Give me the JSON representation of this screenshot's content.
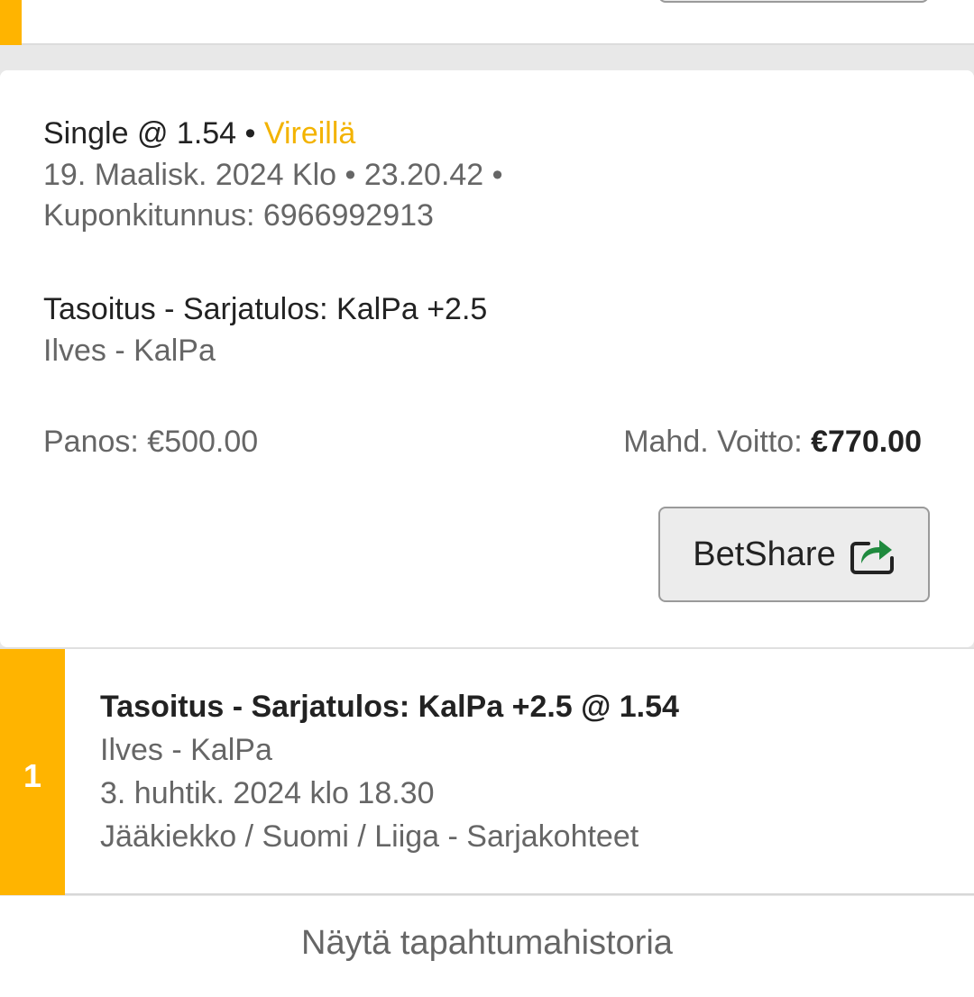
{
  "bet": {
    "type_prefix": "Single @ 1.54",
    "separator": " • ",
    "status": "Vireillä",
    "date_time": "19. Maalisk. 2024 Klo • 23.20.42 •",
    "coupon_id": "Kuponkitunnus: 6966992913",
    "market": "Tasoitus - Sarjatulos: KalPa +2.5",
    "match": "Ilves - KalPa",
    "stake": "Panos: €500.00",
    "winnings_label": "Mahd. Voitto: ",
    "winnings_amount": "€770.00",
    "betshare_label": "BetShare"
  },
  "selection": {
    "number": "1",
    "title": "Tasoitus - Sarjatulos: KalPa +2.5 @ 1.54",
    "match": "Ilves - KalPa",
    "date": "3. huhtik. 2024 klo 18.30",
    "league": "Jääkiekko / Suomi / Liiga - Sarjakohteet"
  },
  "history_link": "Näytä tapahtumahistoria",
  "icons": {
    "share": "share-icon"
  },
  "colors": {
    "accent": "#ffb400",
    "pending": "#f3b300",
    "share_arrow": "#1f8a3e",
    "text_dark": "#222222",
    "text_muted": "#666666"
  }
}
